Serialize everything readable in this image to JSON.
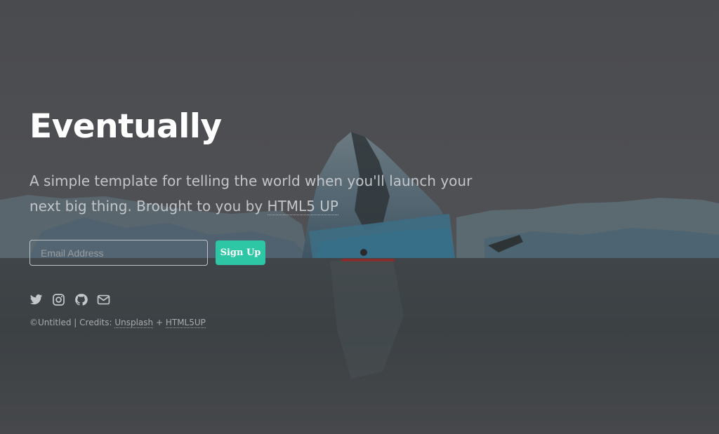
{
  "hero": {
    "title": "Eventually",
    "tagline_text": "A simple template for telling the world when you'll launch your next big thing. Brought to you by ",
    "tagline_link": "HTML5 UP"
  },
  "signup": {
    "email_placeholder": "Email Address",
    "button_label": "Sign Up"
  },
  "social": [
    {
      "name": "twitter-icon"
    },
    {
      "name": "instagram-icon"
    },
    {
      "name": "github-icon"
    },
    {
      "name": "envelope-icon"
    }
  ],
  "footer": {
    "copyright": "©Untitled",
    "separator": " | Credits: ",
    "credit_unsplash": "Unsplash",
    "plus": " + ",
    "credit_html5up": "HTML5UP"
  },
  "colors": {
    "accent": "#2ec7a6",
    "text": "#ffffff",
    "muted": "#c3c6c9"
  }
}
